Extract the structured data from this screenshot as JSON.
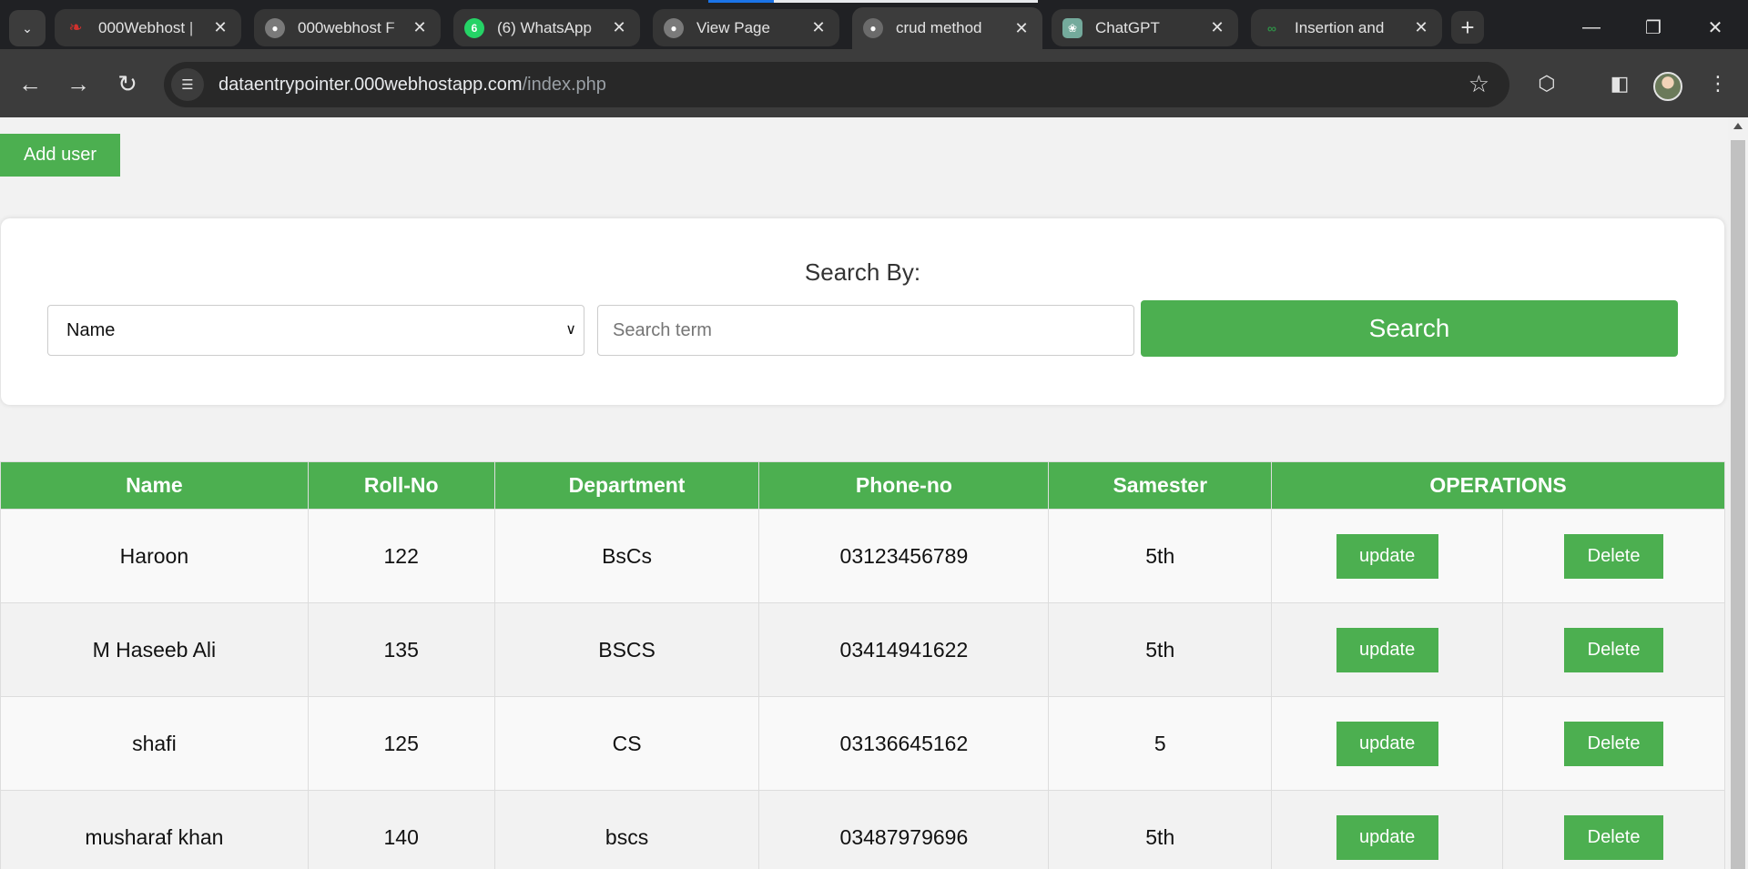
{
  "browser": {
    "tabs": [
      {
        "title": "000Webhost |",
        "favicon": "000webhost-logo-icon",
        "active": false
      },
      {
        "title": "000webhost F",
        "favicon": "globe-icon",
        "active": false
      },
      {
        "title": "(6) WhatsApp",
        "favicon": "whatsapp-icon",
        "badge": "6",
        "active": false
      },
      {
        "title": "View Page",
        "favicon": "globe-icon",
        "active": false
      },
      {
        "title": "crud method",
        "favicon": "globe-icon",
        "active": true
      },
      {
        "title": "ChatGPT",
        "favicon": "chatgpt-icon",
        "active": false
      },
      {
        "title": "Insertion and",
        "favicon": "geeksforgeeks-icon",
        "active": false
      }
    ],
    "url": {
      "host": "dataentrypointer.000webhostapp.com",
      "path": "/index.php"
    },
    "colors": {
      "frame": "#202124",
      "toolbar": "#3c3c3c",
      "accent": "#4caf50"
    }
  },
  "page": {
    "add_user_label": "Add user",
    "search": {
      "title": "Search By:",
      "selected_option": "Name",
      "placeholder": "Search term",
      "button_label": "Search"
    },
    "table": {
      "headers": [
        "Name",
        "Roll-No",
        "Department",
        "Phone-no",
        "Samester",
        "OPERATIONS"
      ],
      "update_label": "update",
      "delete_label": "Delete",
      "rows": [
        {
          "name": "Haroon",
          "roll": "122",
          "department": "BsCs",
          "phone": "03123456789",
          "semester": "5th"
        },
        {
          "name": "M Haseeb Ali",
          "roll": "135",
          "department": "BSCS",
          "phone": "03414941622",
          "semester": "5th"
        },
        {
          "name": "shafi",
          "roll": "125",
          "department": "CS",
          "phone": "03136645162",
          "semester": "5"
        },
        {
          "name": "musharaf khan",
          "roll": "140",
          "department": "bscs",
          "phone": "03487979696",
          "semester": "5th"
        }
      ]
    }
  }
}
